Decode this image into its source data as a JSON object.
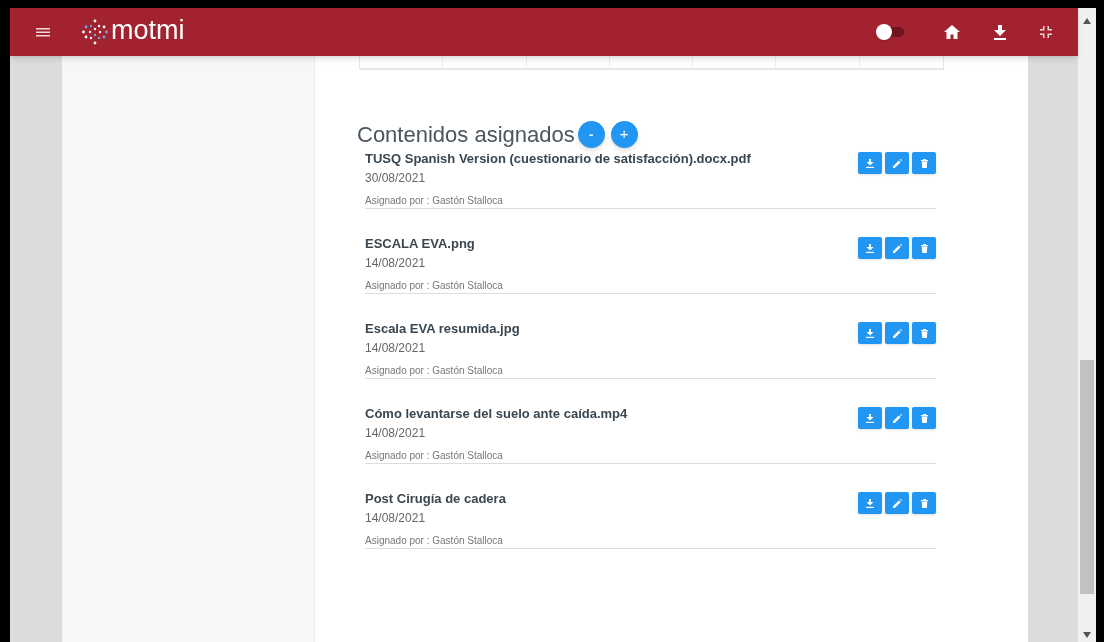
{
  "app_bar": {
    "logo": "motmi",
    "toggle": {
      "on": false
    }
  },
  "section": {
    "title": "Contenidos asignados",
    "collapse_label": "-",
    "add_label": "+"
  },
  "contents": [
    {
      "title": "TUSQ Spanish Version (cuestionario de satisfacción).docx.pdf",
      "date": "30/08/2021",
      "assigned_by": "Asignado por : Gastón Stalloca"
    },
    {
      "title": "ESCALA EVA.png",
      "date": "14/08/2021",
      "assigned_by": "Asignado por : Gastón Stalloca"
    },
    {
      "title": "Escala EVA resumida.jpg",
      "date": "14/08/2021",
      "assigned_by": "Asignado por : Gastón Stalloca"
    },
    {
      "title": "Cómo levantarse del suelo ante caída.mp4",
      "date": "14/08/2021",
      "assigned_by": "Asignado por : Gastón Stalloca"
    },
    {
      "title": "Post Cirugía de cadera",
      "date": "14/08/2021",
      "assigned_by": "Asignado por : Gastón Stalloca"
    }
  ]
}
